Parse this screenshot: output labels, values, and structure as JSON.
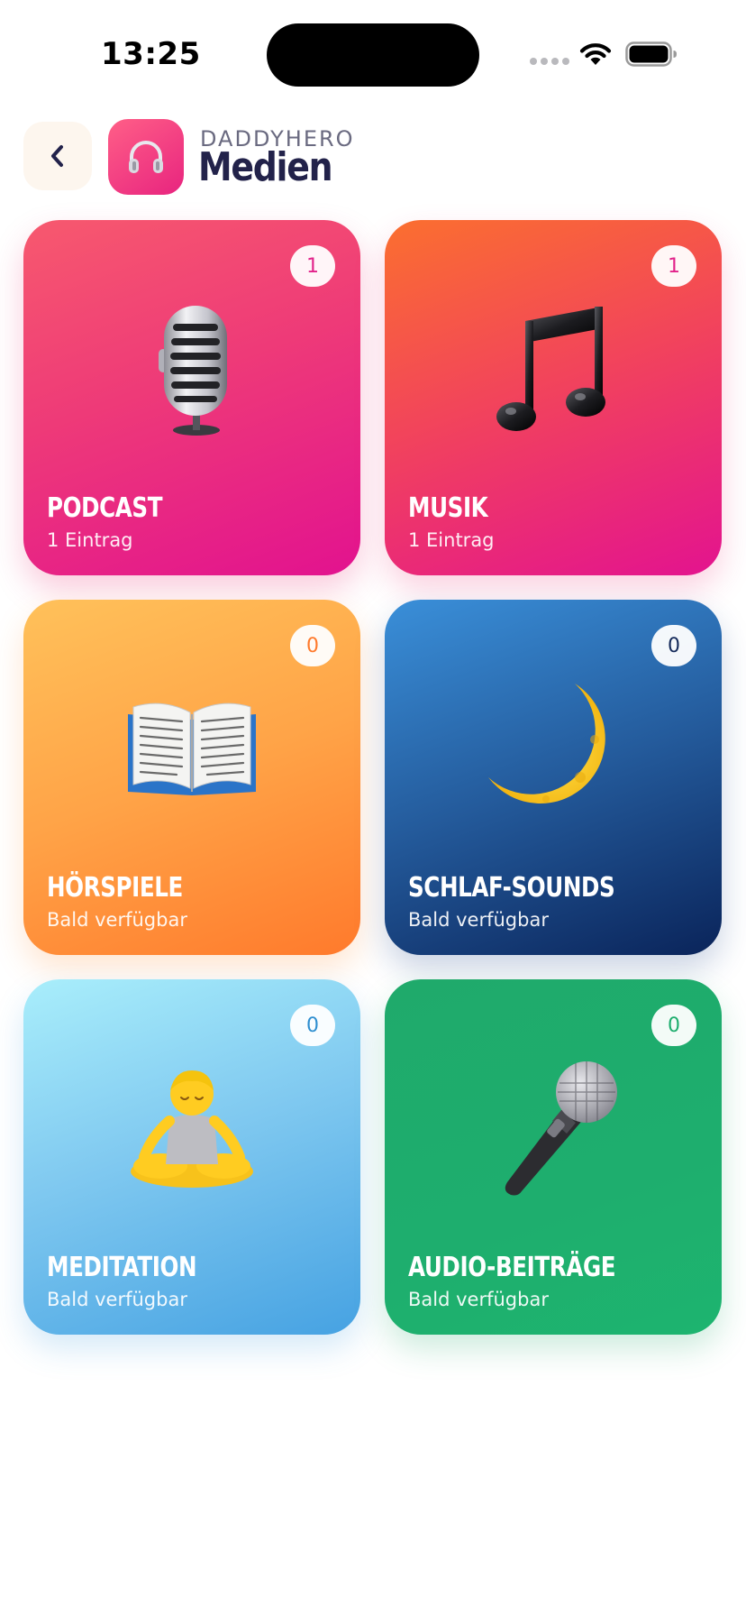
{
  "status_bar": {
    "time": "13:25"
  },
  "header": {
    "back_icon": "chevron-left-icon",
    "app_icon": "headphones-icon",
    "brand": "DADDYHERO",
    "title": "Medien"
  },
  "categories": [
    {
      "title": "PODCAST",
      "subtitle": "1 Eintrag",
      "count": "1",
      "icon": "studio-microphone-icon",
      "accent": "#e2228a"
    },
    {
      "title": "MUSIK",
      "subtitle": "1 Eintrag",
      "count": "1",
      "icon": "music-notes-icon",
      "accent": "#e2228a"
    },
    {
      "title": "HÖRSPIELE",
      "subtitle": "Bald verfügbar",
      "count": "0",
      "icon": "open-book-icon",
      "accent": "#ff7a2c"
    },
    {
      "title": "SCHLAF-SOUNDS",
      "subtitle": "Bald verfügbar",
      "count": "0",
      "icon": "crescent-moon-icon",
      "accent": "#142a5a"
    },
    {
      "title": "MEDITATION",
      "subtitle": "Bald verfügbar",
      "count": "0",
      "icon": "person-meditating-icon",
      "accent": "#2f8fd0"
    },
    {
      "title": "AUDIO-BEITRÄGE",
      "subtitle": "Bald verfügbar",
      "count": "0",
      "icon": "handheld-microphone-icon",
      "accent": "#1eae6e"
    }
  ]
}
